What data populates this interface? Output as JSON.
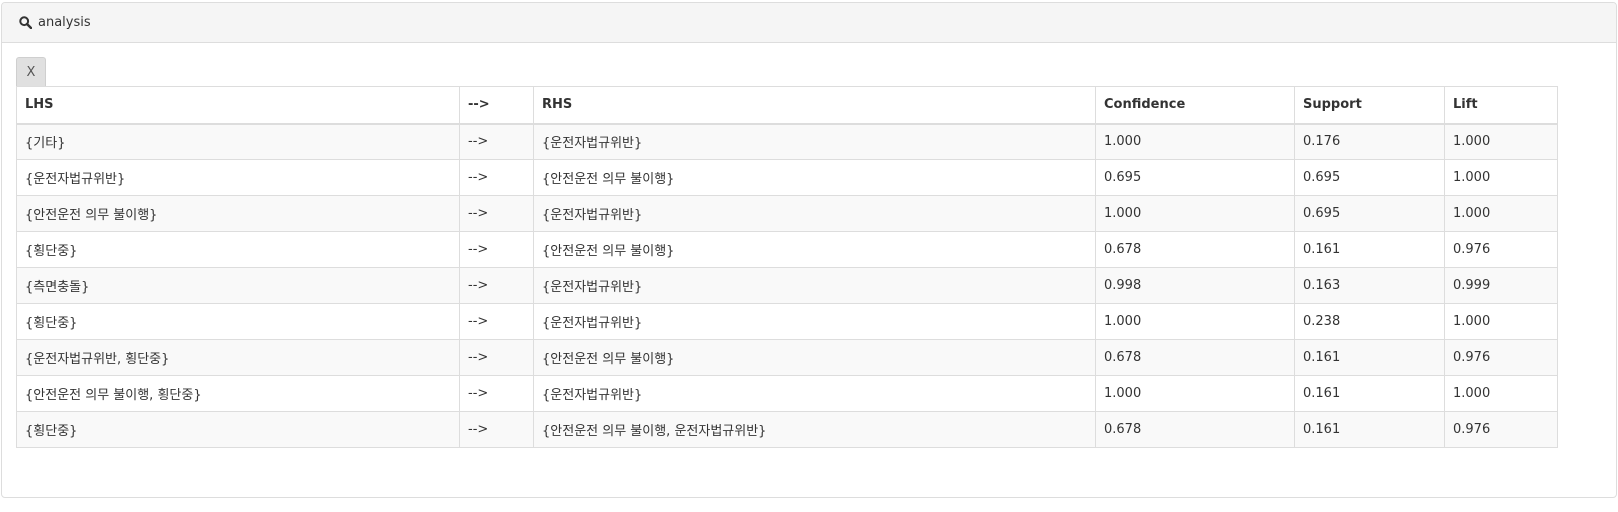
{
  "panel": {
    "title": "analysis",
    "icon": "search-icon",
    "close_label": "X"
  },
  "table": {
    "headers": [
      "LHS",
      "-->",
      "RHS",
      "Confidence",
      "Support",
      "Lift"
    ],
    "rows": [
      [
        "{기타}",
        "-->",
        "{운전자법규위반}",
        "1.000",
        "0.176",
        "1.000"
      ],
      [
        "{운전자법규위반}",
        "-->",
        "{안전운전 의무 불이행}",
        "0.695",
        "0.695",
        "1.000"
      ],
      [
        "{안전운전 의무 불이행}",
        "-->",
        "{운전자법규위반}",
        "1.000",
        "0.695",
        "1.000"
      ],
      [
        "{횡단중}",
        "-->",
        "{안전운전 의무 불이행}",
        "0.678",
        "0.161",
        "0.976"
      ],
      [
        "{측면충돌}",
        "-->",
        "{운전자법규위반}",
        "0.998",
        "0.163",
        "0.999"
      ],
      [
        "{횡단중}",
        "-->",
        "{운전자법규위반}",
        "1.000",
        "0.238",
        "1.000"
      ],
      [
        "{운전자법규위반, 횡단중}",
        "-->",
        "{안전운전 의무 불이행}",
        "0.678",
        "0.161",
        "0.976"
      ],
      [
        "{안전운전 의무 불이행, 횡단중}",
        "-->",
        "{운전자법규위반}",
        "1.000",
        "0.161",
        "1.000"
      ],
      [
        "{횡단중}",
        "-->",
        "{안전운전 의무 불이행, 운전자법규위반}",
        "0.678",
        "0.161",
        "0.976"
      ]
    ]
  }
}
